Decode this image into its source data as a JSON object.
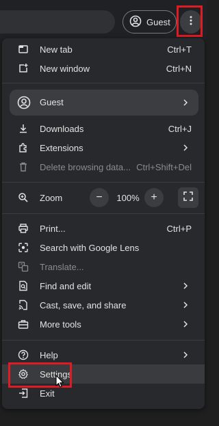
{
  "toolbar": {
    "guest_label": "Guest"
  },
  "menu": {
    "new_tab": {
      "label": "New tab",
      "shortcut": "Ctrl+T"
    },
    "new_window": {
      "label": "New window",
      "shortcut": "Ctrl+N"
    },
    "profile": {
      "label": "Guest"
    },
    "downloads": {
      "label": "Downloads",
      "shortcut": "Ctrl+J"
    },
    "extensions": {
      "label": "Extensions"
    },
    "delete_data": {
      "label": "Delete browsing data...",
      "shortcut": "Ctrl+Shift+Del"
    },
    "zoom": {
      "label": "Zoom",
      "value": "100%",
      "minus": "−",
      "plus": "+"
    },
    "print": {
      "label": "Print...",
      "shortcut": "Ctrl+P"
    },
    "lens": {
      "label": "Search with Google Lens"
    },
    "translate": {
      "label": "Translate..."
    },
    "find_edit": {
      "label": "Find and edit"
    },
    "cast_save": {
      "label": "Cast, save, and share"
    },
    "more_tools": {
      "label": "More tools"
    },
    "help": {
      "label": "Help"
    },
    "settings": {
      "label": "Settings"
    },
    "exit": {
      "label": "Exit"
    }
  },
  "colors": {
    "highlight_box": "#e01b24",
    "menu_bg": "#28292c",
    "disabled_text": "#8a8b8e"
  },
  "icons": [
    "guest-avatar-icon",
    "kebab-menu-icon",
    "new-tab-icon",
    "new-window-icon",
    "download-icon",
    "extension-icon",
    "trash-icon",
    "zoom-icon",
    "fullscreen-icon",
    "print-icon",
    "lens-icon",
    "translate-icon",
    "find-icon",
    "cast-icon",
    "toolbox-icon",
    "help-icon",
    "gear-icon",
    "exit-icon",
    "chevron-right-icon",
    "mouse-cursor-icon"
  ]
}
